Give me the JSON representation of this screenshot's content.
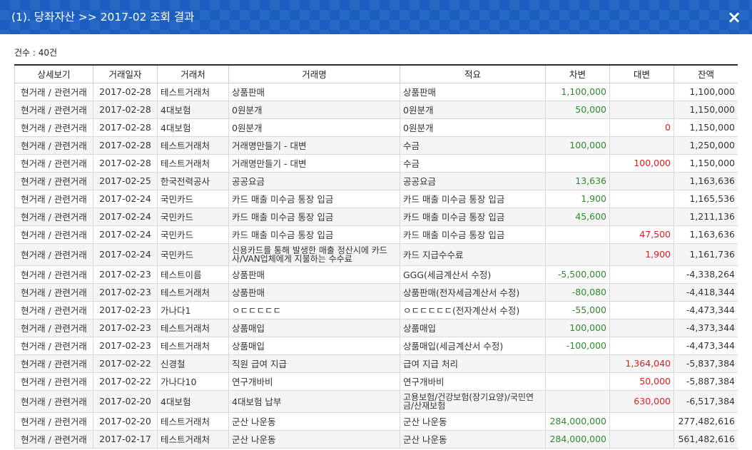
{
  "header": {
    "title": "(1). 당좌자산 >> 2017-02 조회 결과",
    "close_icon": "×"
  },
  "summary": {
    "count_label": "건수 : 40건"
  },
  "table": {
    "columns": [
      "상세보기",
      "거래일자",
      "거래처",
      "거래명",
      "적요",
      "차변",
      "대변",
      "잔액"
    ],
    "rows": [
      {
        "detail": "현거래 / 관련거래",
        "date": "2017-02-28",
        "partner": "테스트거래처",
        "name": "상품판매",
        "memo": "상품판매",
        "debit": "1,100,000",
        "credit": "",
        "balance": "1,100,000"
      },
      {
        "detail": "현거래 / 관련거래",
        "date": "2017-02-28",
        "partner": "4대보험",
        "name": "0원분개",
        "memo": "0원분개",
        "debit": "50,000",
        "credit": "",
        "balance": "1,150,000"
      },
      {
        "detail": "현거래 / 관련거래",
        "date": "2017-02-28",
        "partner": "4대보험",
        "name": "0원분개",
        "memo": "0원분개",
        "debit": "",
        "credit": "0",
        "balance": "1,150,000"
      },
      {
        "detail": "현거래 / 관련거래",
        "date": "2017-02-28",
        "partner": "테스트거래처",
        "name": "거래명만들기 - 대변",
        "memo": "수금",
        "debit": "100,000",
        "credit": "",
        "balance": "1,250,000"
      },
      {
        "detail": "현거래 / 관련거래",
        "date": "2017-02-28",
        "partner": "테스트거래처",
        "name": "거래명만들기 - 대변",
        "memo": "수금",
        "debit": "",
        "credit": "100,000",
        "balance": "1,150,000"
      },
      {
        "detail": "현거래 / 관련거래",
        "date": "2017-02-25",
        "partner": "한국전력공사",
        "name": "공공요금",
        "memo": "공공요금",
        "debit": "13,636",
        "credit": "",
        "balance": "1,163,636"
      },
      {
        "detail": "현거래 / 관련거래",
        "date": "2017-02-24",
        "partner": "국민카드",
        "name": "카드 매출 미수금 통장 입금",
        "memo": "카드 매출 미수금 통장 입금",
        "debit": "1,900",
        "credit": "",
        "balance": "1,165,536"
      },
      {
        "detail": "현거래 / 관련거래",
        "date": "2017-02-24",
        "partner": "국민카드",
        "name": "카드 매출 미수금 통장 입금",
        "memo": "카드 매출 미수금 통장 입금",
        "debit": "45,600",
        "credit": "",
        "balance": "1,211,136"
      },
      {
        "detail": "현거래 / 관련거래",
        "date": "2017-02-24",
        "partner": "국민카드",
        "name": "카드 매출 미수금 통장 입금",
        "memo": "카드 매출 미수금 통장 입금",
        "debit": "",
        "credit": "47,500",
        "balance": "1,163,636"
      },
      {
        "detail": "현거래 / 관련거래",
        "date": "2017-02-24",
        "partner": "국민카드",
        "name": "신용카드를 통해 발생한 매출 정산시에 카드사/VAN업체에게 지불하는 수수료",
        "memo": "카드 지급수수료",
        "debit": "",
        "credit": "1,900",
        "balance": "1,161,736"
      },
      {
        "detail": "현거래 / 관련거래",
        "date": "2017-02-23",
        "partner": "테스트이름",
        "name": "상품판매",
        "memo": "GGG(세금계산서 수정)",
        "debit": "-5,500,000",
        "credit": "",
        "balance": "-4,338,264"
      },
      {
        "detail": "현거래 / 관련거래",
        "date": "2017-02-23",
        "partner": "테스트거래처",
        "name": "상품판매",
        "memo": "상품판매(전자세금계산서 수정)",
        "debit": "-80,080",
        "credit": "",
        "balance": "-4,418,344"
      },
      {
        "detail": "현거래 / 관련거래",
        "date": "2017-02-23",
        "partner": "가나다1",
        "name": "ㅇㄷㄷㄷㄷㄷ",
        "memo": "ㅇㄷㄷㄷㄷㄷ(전자계산서 수정)",
        "debit": "-55,000",
        "credit": "",
        "balance": "-4,473,344"
      },
      {
        "detail": "현거래 / 관련거래",
        "date": "2017-02-23",
        "partner": "테스트거래처",
        "name": "상품매입",
        "memo": "상품매입",
        "debit": "100,000",
        "credit": "",
        "balance": "-4,373,344"
      },
      {
        "detail": "현거래 / 관련거래",
        "date": "2017-02-23",
        "partner": "테스트거래처",
        "name": "상품매입",
        "memo": "상품매입(세금계산서 수정)",
        "debit": "-100,000",
        "credit": "",
        "balance": "-4,473,344"
      },
      {
        "detail": "현거래 / 관련거래",
        "date": "2017-02-22",
        "partner": "신경철",
        "name": "직원 급여 지급",
        "memo": "급여 지급 처리",
        "debit": "",
        "credit": "1,364,040",
        "balance": "-5,837,384"
      },
      {
        "detail": "현거래 / 관련거래",
        "date": "2017-02-22",
        "partner": "가나다10",
        "name": "연구개바비",
        "memo": "연구개바비",
        "debit": "",
        "credit": "50,000",
        "balance": "-5,887,384"
      },
      {
        "detail": "현거래 / 관련거래",
        "date": "2017-02-20",
        "partner": "4대보험",
        "name": "4대보험 납부",
        "memo": "고용보험/건강보험(장기요양)/국민연금/산재보험",
        "debit": "",
        "credit": "630,000",
        "balance": "-6,517,384"
      },
      {
        "detail": "현거래 / 관련거래",
        "date": "2017-02-20",
        "partner": "테스트거래처",
        "name": "군산 나운동",
        "memo": "군산 나운동",
        "debit": "284,000,000",
        "credit": "",
        "balance": "277,482,616"
      },
      {
        "detail": "현거래 / 관련거래",
        "date": "2017-02-17",
        "partner": "테스트거래처",
        "name": "군산 나운동",
        "memo": "군산 나운동",
        "debit": "284,000,000",
        "credit": "",
        "balance": "561,482,616"
      }
    ]
  },
  "colors": {
    "header_bg": "#1a5fc0",
    "debit_text": "#2e8b2e",
    "credit_text": "#e02020"
  }
}
